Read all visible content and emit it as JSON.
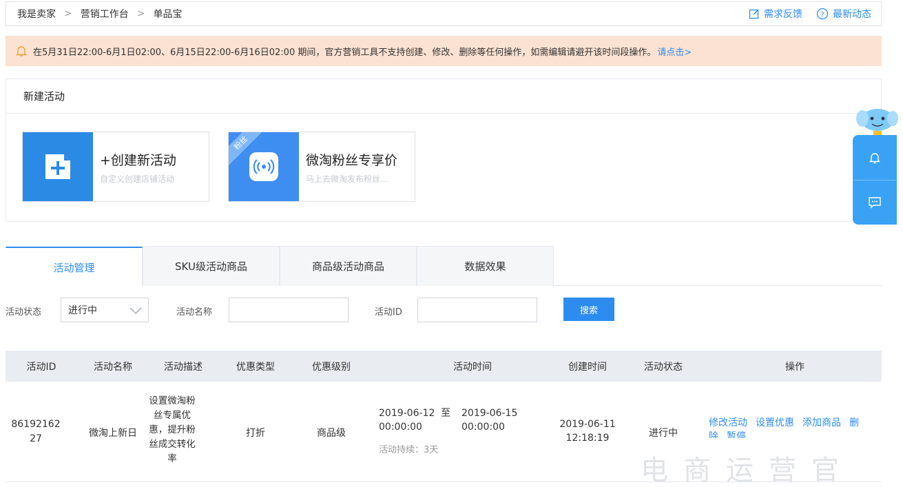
{
  "breadcrumb": [
    "我是卖家",
    "营销工作台",
    "单品宝"
  ],
  "breadcrumb_sep": ">",
  "header_links": {
    "feedback": "需求反馈",
    "news": "最新动态"
  },
  "notice": {
    "text": "在5月31日22:00-6月1日02:00、6月15日22:00-6月16日02:00 期间，官方营销工具不支持创建、修改、删除等任何操作，如需编辑请避开该时间段操作。",
    "link": "请点击>"
  },
  "new_activity": {
    "title": "新建活动",
    "cards": [
      {
        "title": "+创建新活动",
        "desc": "自定义创建店铺活动"
      },
      {
        "title": "微淘粉丝专享价",
        "desc": "马上去微淘发布粉丝...",
        "ribbon": "粉丝"
      }
    ]
  },
  "tabs": [
    "活动管理",
    "SKU级活动商品",
    "商品级活动商品",
    "数据效果"
  ],
  "filters": {
    "status_label": "活动状态",
    "status_value": "进行中",
    "name_label": "活动名称",
    "name_value": "",
    "id_label": "活动ID",
    "id_value": "",
    "search_button": "搜索"
  },
  "table": {
    "headers": [
      "活动ID",
      "活动名称",
      "活动描述",
      "优惠类型",
      "优惠级别",
      "活动时间",
      "创建时间",
      "活动状态",
      "操作"
    ],
    "rows": [
      {
        "id": "8619216227",
        "name": "微淘上新日",
        "desc": "设置微淘粉丝专属优惠，提升粉丝成交转化率",
        "discount_type": "打折",
        "level": "商品级",
        "start_date": "2019-06-12",
        "start_time": "00:00:00",
        "to": "至",
        "end_date": "2019-06-15",
        "end_time": "00:00:00",
        "duration": "活动持续：3天",
        "created_date": "2019-06-11",
        "created_time": "12:18:19",
        "status": "进行中",
        "actions": [
          "修改活动",
          "设置优惠",
          "添加商品",
          "删除",
          "暂停"
        ]
      }
    ]
  },
  "watermark": "电商运营官",
  "colors": {
    "accent": "#2d8cf0",
    "notice_bg": "#fbe2d2",
    "widget": "#39a2f5"
  }
}
